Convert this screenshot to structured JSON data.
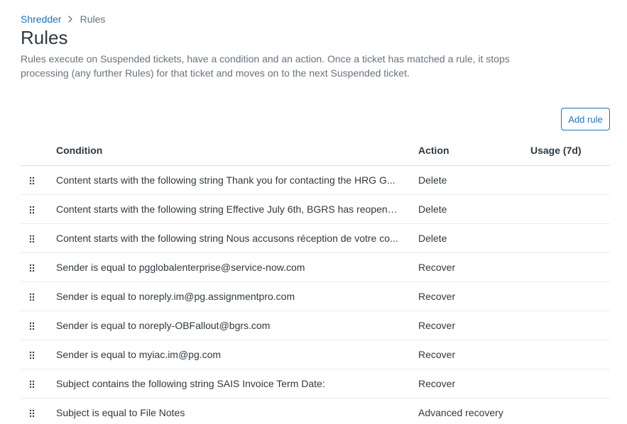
{
  "breadcrumb": {
    "parent": "Shredder",
    "current": "Rules"
  },
  "header": {
    "title": "Rules",
    "description": "Rules execute on Suspended tickets, have a condition and an action. Once a ticket has matched a rule, it stops processing (any further Rules) for that ticket and moves on to the next Suspended ticket."
  },
  "toolbar": {
    "add_rule_label": "Add rule"
  },
  "table": {
    "columns": {
      "condition": "Condition",
      "action": "Action",
      "usage": "Usage (7d)"
    },
    "rows": [
      {
        "condition": "Content starts with the following string Thank you for contacting the HRG G...",
        "action": "Delete",
        "usage": ""
      },
      {
        "condition": "Content starts with the following string Effective July 6th, BGRS has reopened...",
        "action": "Delete",
        "usage": ""
      },
      {
        "condition": "Content starts with the following string Nous accusons réception de votre co...",
        "action": "Delete",
        "usage": ""
      },
      {
        "condition": "Sender is equal to pgglobalenterprise@service-now.com",
        "action": "Recover",
        "usage": ""
      },
      {
        "condition": "Sender is equal to noreply.im@pg.assignmentpro.com",
        "action": "Recover",
        "usage": ""
      },
      {
        "condition": "Sender is equal to noreply-OBFallout@bgrs.com",
        "action": "Recover",
        "usage": ""
      },
      {
        "condition": "Sender is equal to myiac.im@pg.com",
        "action": "Recover",
        "usage": ""
      },
      {
        "condition": "Subject contains the following string SAIS Invoice Term Date:",
        "action": "Recover",
        "usage": ""
      },
      {
        "condition": "Subject is equal to File Notes",
        "action": "Advanced recovery",
        "usage": ""
      }
    ]
  },
  "icons": {
    "separator": "chevron-right-icon",
    "row_handle": "drag-handle-icon"
  },
  "colors": {
    "link": "#1f73b7",
    "text": "#2f3941",
    "muted": "#68737d",
    "divider": "#d8dcde"
  }
}
